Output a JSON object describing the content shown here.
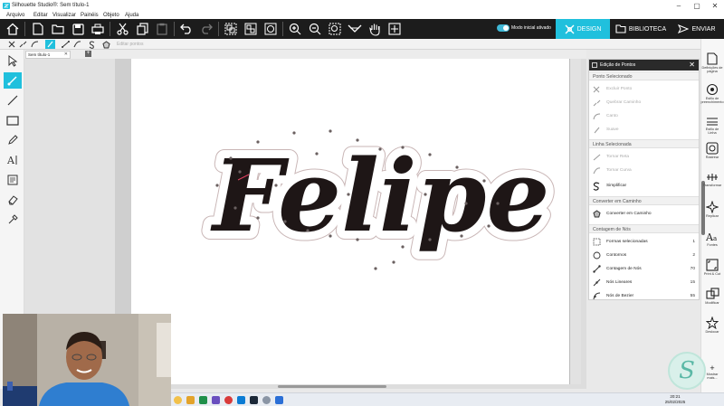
{
  "window": {
    "title": "Silhouette Studio®: Sem título-1",
    "controls": [
      "–",
      "▢",
      "✕"
    ]
  },
  "menu": [
    "Arquivo",
    "Editar",
    "Visualizar",
    "Painéis",
    "Objeto",
    "Ajuda"
  ],
  "toolbar": {
    "startup_mode_label": "Modo inicial ativado",
    "startup_mode_on": true,
    "tabs": {
      "design": "DESIGN",
      "biblioteca": "BIBLIOTECA",
      "enviar": "ENVIAR"
    },
    "accent_color": "#20c0dd"
  },
  "subtoolbar": {
    "edit_panel_label": "Editar pontos"
  },
  "document_tab": {
    "name": "Sem título-1",
    "close": "✕",
    "add": "+"
  },
  "canvas": {
    "design_text": "Felipe"
  },
  "point_panel": {
    "title": "Edição de Pontos",
    "close": "✕",
    "sections": {
      "selected_point": "Ponto Selecionado",
      "selected_line": "Linha Selecionada",
      "convert_path": "Converter em Caminho",
      "node_count": "Contagem de Nós"
    },
    "point_actions": [
      "Excluir Ponto",
      "Quebrar Caminho",
      "Canto",
      "Suave"
    ],
    "line_actions": [
      "Tornar Reta",
      "Tornar Curva",
      "Simplificar"
    ],
    "convert_action": "Converter em Caminho",
    "counts": [
      {
        "label": "Formas selecionadas",
        "value": "1"
      },
      {
        "label": "Contornos",
        "value": "2"
      },
      {
        "label": "Contagem de Nós",
        "value": "70"
      },
      {
        "label": "Nós Lineares",
        "value": "15"
      },
      {
        "label": "Nós de Bezier",
        "value": "55"
      }
    ]
  },
  "right_panel": [
    {
      "label": "Definições de página",
      "icon": "page-settings-icon"
    },
    {
      "label": "Estilo de preenchimento",
      "icon": "fill-style-icon"
    },
    {
      "label": "Estilo de Linha",
      "icon": "line-style-icon"
    },
    {
      "label": "Rastrear",
      "icon": "trace-icon"
    },
    {
      "label": "Transformar",
      "icon": "transform-icon"
    },
    {
      "label": "Replicar",
      "icon": "replicate-icon"
    },
    {
      "label": "Fontes",
      "icon": "fonts-icon"
    },
    {
      "label": "Print & Cut",
      "icon": "print-cut-icon"
    },
    {
      "label": "Modificar",
      "icon": "modify-icon"
    },
    {
      "label": "Deslocar",
      "icon": "offset-icon"
    },
    {
      "label": "Mostrar mais...",
      "icon": "show-more-icon"
    }
  ],
  "taskbar": {
    "time": "20:21",
    "date": "25/02/2025"
  }
}
